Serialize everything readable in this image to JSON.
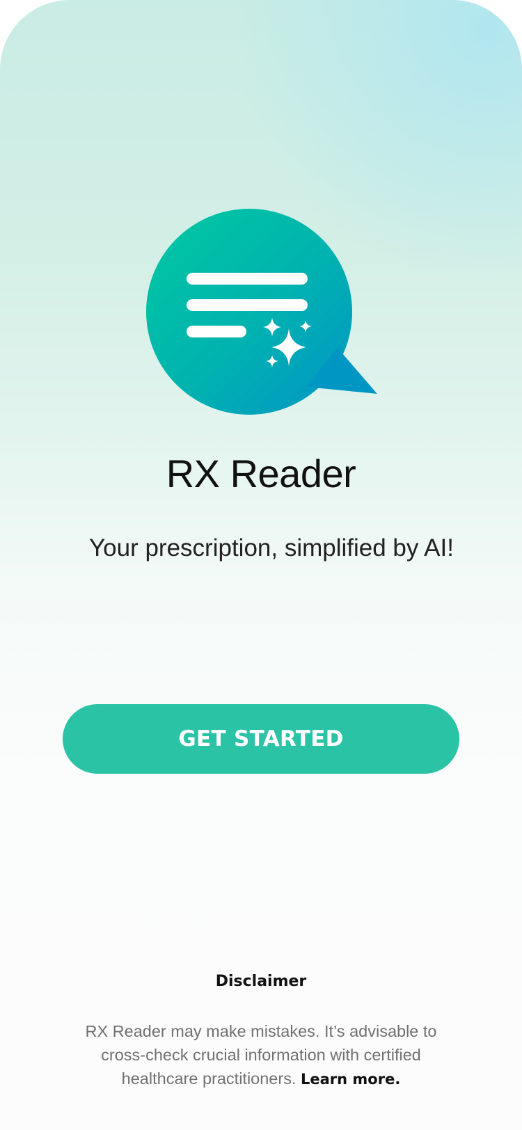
{
  "app": {
    "title": "RX Reader",
    "tagline": "Your prescription, simplified by AI!",
    "logo_icon": "chat-bubble-sparkle-icon"
  },
  "actions": {
    "get_started_label": "GET STARTED"
  },
  "disclaimer": {
    "title": "Disclaimer",
    "body": "RX Reader may make mistakes. It’s advisable to cross-check crucial information with certified healthcare practitioners. ",
    "link_label": "Learn more",
    "trailing": "."
  },
  "colors": {
    "accent": "#2bc3a6",
    "logo_gradient_start": "#00c4a0",
    "logo_gradient_end": "#0097c7"
  }
}
